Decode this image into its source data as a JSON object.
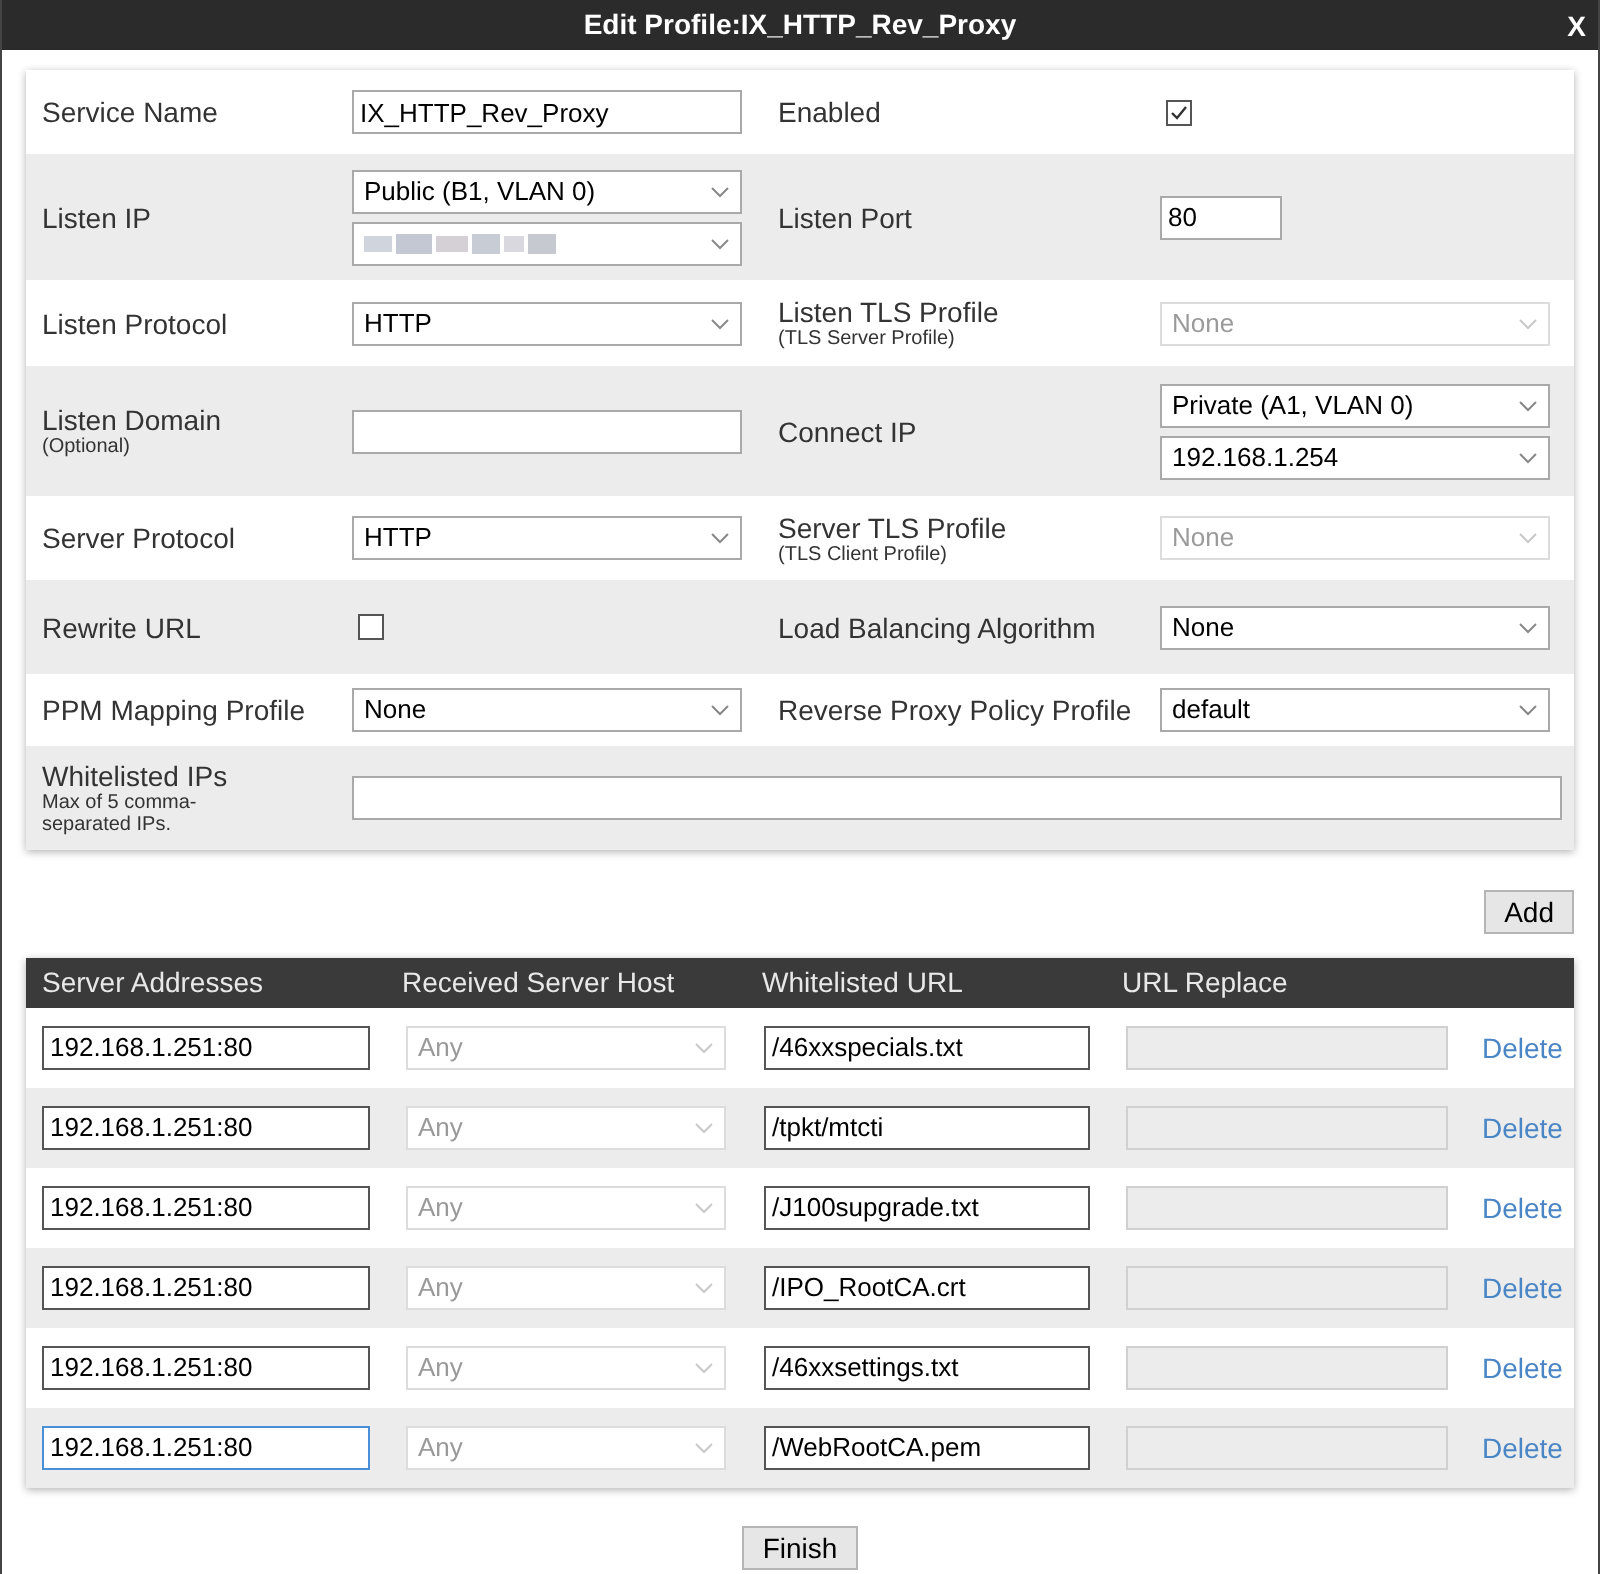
{
  "window": {
    "title": "Edit Profile:IX_HTTP_Rev_Proxy",
    "close": "X"
  },
  "form_rows": [
    {
      "left": {
        "label": "Service Name",
        "controls": [
          {
            "kind": "text",
            "value": "IX_HTTP_Rev_Proxy"
          }
        ]
      },
      "right": {
        "label": "Enabled",
        "controls": [
          {
            "kind": "checkbox",
            "checked": true
          }
        ]
      }
    },
    {
      "left": {
        "label": "Listen IP",
        "controls": [
          {
            "kind": "select",
            "value": "Public (B1, VLAN 0)",
            "disabled": false
          },
          {
            "kind": "redacted"
          }
        ]
      },
      "right": {
        "label": "Listen Port",
        "controls": [
          {
            "kind": "short_text",
            "value": "80"
          }
        ]
      }
    },
    {
      "left": {
        "label": "Listen Protocol",
        "controls": [
          {
            "kind": "select",
            "value": "HTTP",
            "disabled": false
          }
        ]
      },
      "right": {
        "label": "Listen TLS Profile",
        "sublabel": "(TLS Server Profile)",
        "controls": [
          {
            "kind": "select",
            "value": "None",
            "disabled": true
          }
        ]
      }
    },
    {
      "left": {
        "label": "Listen Domain",
        "sublabel": "(Optional)",
        "controls": [
          {
            "kind": "text"
          }
        ]
      },
      "right": {
        "label": "Connect IP",
        "controls": [
          {
            "kind": "select",
            "value": "Private (A1, VLAN 0)",
            "disabled": false
          },
          {
            "kind": "select",
            "value": "192.168.1.254",
            "disabled": false
          }
        ]
      }
    },
    {
      "left": {
        "label": "Server Protocol",
        "controls": [
          {
            "kind": "select",
            "value": "HTTP",
            "disabled": false
          }
        ]
      },
      "right": {
        "label": "Server TLS Profile",
        "sublabel": "(TLS Client Profile)",
        "controls": [
          {
            "kind": "select",
            "value": "None",
            "disabled": true
          }
        ]
      }
    },
    {
      "left": {
        "label": "Rewrite URL",
        "controls": [
          {
            "kind": "checkbox",
            "checked": false
          }
        ]
      },
      "right": {
        "label": "Load Balancing Algorithm",
        "controls": [
          {
            "kind": "select",
            "value": "None",
            "disabled": false
          }
        ]
      }
    },
    {
      "left": {
        "label": "PPM Mapping Profile",
        "controls": [
          {
            "kind": "select",
            "value": "None",
            "disabled": false
          }
        ]
      },
      "right": {
        "label": "Reverse Proxy Policy Profile",
        "controls": [
          {
            "kind": "select",
            "value": "default",
            "disabled": false
          }
        ]
      }
    },
    {
      "left": {
        "label": "Whitelisted IPs",
        "sublabel": "Max of 5 comma-separated IPs.",
        "controls": [
          {
            "kind": "wide_text"
          }
        ]
      }
    }
  ],
  "add_button": "Add",
  "table": {
    "columns": [
      "Server Addresses",
      "Received Server Host",
      "Whitelisted URL",
      "URL Replace"
    ],
    "rows": [
      {
        "address": "192.168.1.251:80",
        "focused": false,
        "host": "Any",
        "host_disabled": true,
        "url": "/46xxspecials.txt",
        "action": "Delete"
      },
      {
        "address": "192.168.1.251:80",
        "focused": false,
        "host": "Any",
        "host_disabled": true,
        "url": "/tpkt/mtcti",
        "action": "Delete"
      },
      {
        "address": "192.168.1.251:80",
        "focused": false,
        "host": "Any",
        "host_disabled": true,
        "url": "/J100supgrade.txt",
        "action": "Delete"
      },
      {
        "address": "192.168.1.251:80",
        "focused": false,
        "host": "Any",
        "host_disabled": true,
        "url": "/IPO_RootCA.crt",
        "action": "Delete"
      },
      {
        "address": "192.168.1.251:80",
        "focused": false,
        "host": "Any",
        "host_disabled": true,
        "url": "/46xxsettings.txt",
        "action": "Delete"
      },
      {
        "address": "192.168.1.251:80",
        "focused": true,
        "host": "Any",
        "host_disabled": true,
        "url": "/WebRootCA.pem",
        "action": "Delete"
      }
    ]
  },
  "finish_button": "Finish"
}
